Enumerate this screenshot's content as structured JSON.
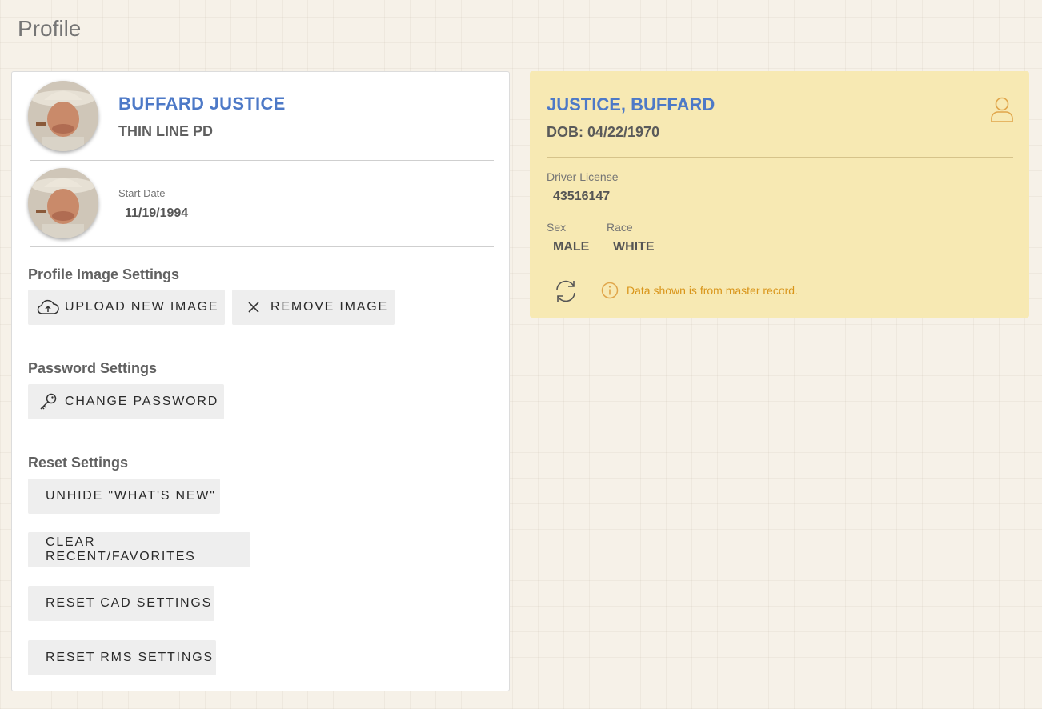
{
  "page": {
    "title": "Profile"
  },
  "profile": {
    "name": "BUFFARD JUSTICE",
    "agency": "THIN LINE PD",
    "start_date_label": "Start Date",
    "start_date": "11/19/1994"
  },
  "image_settings": {
    "heading": "Profile Image Settings",
    "upload_label": "UPLOAD NEW IMAGE",
    "remove_label": "REMOVE IMAGE"
  },
  "password_settings": {
    "heading": "Password Settings",
    "change_label": "CHANGE PASSWORD"
  },
  "reset_settings": {
    "heading": "Reset Settings",
    "buttons": [
      "UNHIDE \"WHAT'S NEW\"",
      "CLEAR RECENT/FAVORITES",
      "RESET CAD SETTINGS",
      "RESET RMS SETTINGS"
    ]
  },
  "master_record": {
    "name": "JUSTICE, BUFFARD",
    "dob": "DOB: 04/22/1970",
    "driver_license_label": "Driver License",
    "driver_license": "43516147",
    "sex_label": "Sex",
    "sex": "MALE",
    "race_label": "Race",
    "race": "WHITE",
    "note": "Data shown is from master record."
  },
  "icons": {
    "upload": "cloud-upload-icon",
    "remove": "close-icon",
    "password": "key-icon",
    "person": "person-icon",
    "refresh": "refresh-icon",
    "info": "info-icon"
  },
  "colors": {
    "accent_blue": "#4d79c7",
    "master_card_bg": "#f7e9b3",
    "warning_orange": "#d9951a",
    "button_bg": "#eeeeee"
  }
}
